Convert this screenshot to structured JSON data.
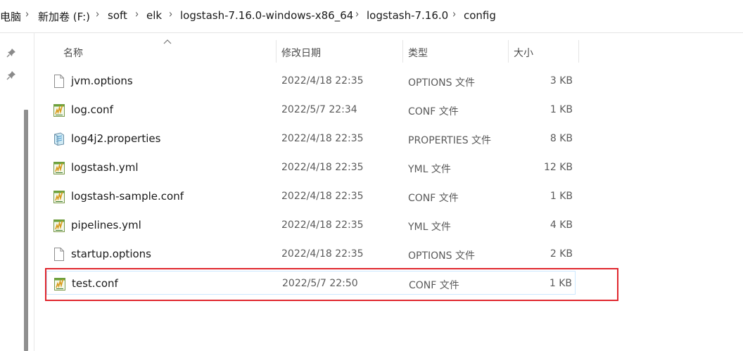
{
  "breadcrumb": [
    {
      "label": "电脑"
    },
    {
      "label": "新加卷 (F:)"
    },
    {
      "label": "soft"
    },
    {
      "label": "elk"
    },
    {
      "label": "logstash-7.16.0-windows-x86_64"
    },
    {
      "label": "logstash-7.16.0"
    },
    {
      "label": "config"
    }
  ],
  "columns": {
    "name": "名称",
    "modified": "修改日期",
    "type": "类型",
    "size": "大小"
  },
  "files": [
    {
      "name": "jvm.options",
      "modified": "2022/4/18 22:35",
      "type": "OPTIONS 文件",
      "size": "3 KB",
      "icon": "generic-file-icon"
    },
    {
      "name": "log.conf",
      "modified": "2022/5/7 22:34",
      "type": "CONF 文件",
      "size": "1 KB",
      "icon": "text-editor-file-icon"
    },
    {
      "name": "log4j2.properties",
      "modified": "2022/4/18 22:35",
      "type": "PROPERTIES 文件",
      "size": "8 KB",
      "icon": "properties-file-icon"
    },
    {
      "name": "logstash.yml",
      "modified": "2022/4/18 22:35",
      "type": "YML 文件",
      "size": "12 KB",
      "icon": "text-editor-file-icon"
    },
    {
      "name": "logstash-sample.conf",
      "modified": "2022/4/18 22:35",
      "type": "CONF 文件",
      "size": "1 KB",
      "icon": "text-editor-file-icon"
    },
    {
      "name": "pipelines.yml",
      "modified": "2022/4/18 22:35",
      "type": "YML 文件",
      "size": "4 KB",
      "icon": "text-editor-file-icon"
    },
    {
      "name": "startup.options",
      "modified": "2022/4/18 22:35",
      "type": "OPTIONS 文件",
      "size": "2 KB",
      "icon": "generic-file-icon"
    },
    {
      "name": "test.conf",
      "modified": "2022/5/7 22:50",
      "type": "CONF 文件",
      "size": "1 KB",
      "icon": "text-editor-file-icon",
      "selected": true
    }
  ],
  "colors": {
    "highlight_box": "#e0262d",
    "selection_border": "#cde8ff"
  }
}
